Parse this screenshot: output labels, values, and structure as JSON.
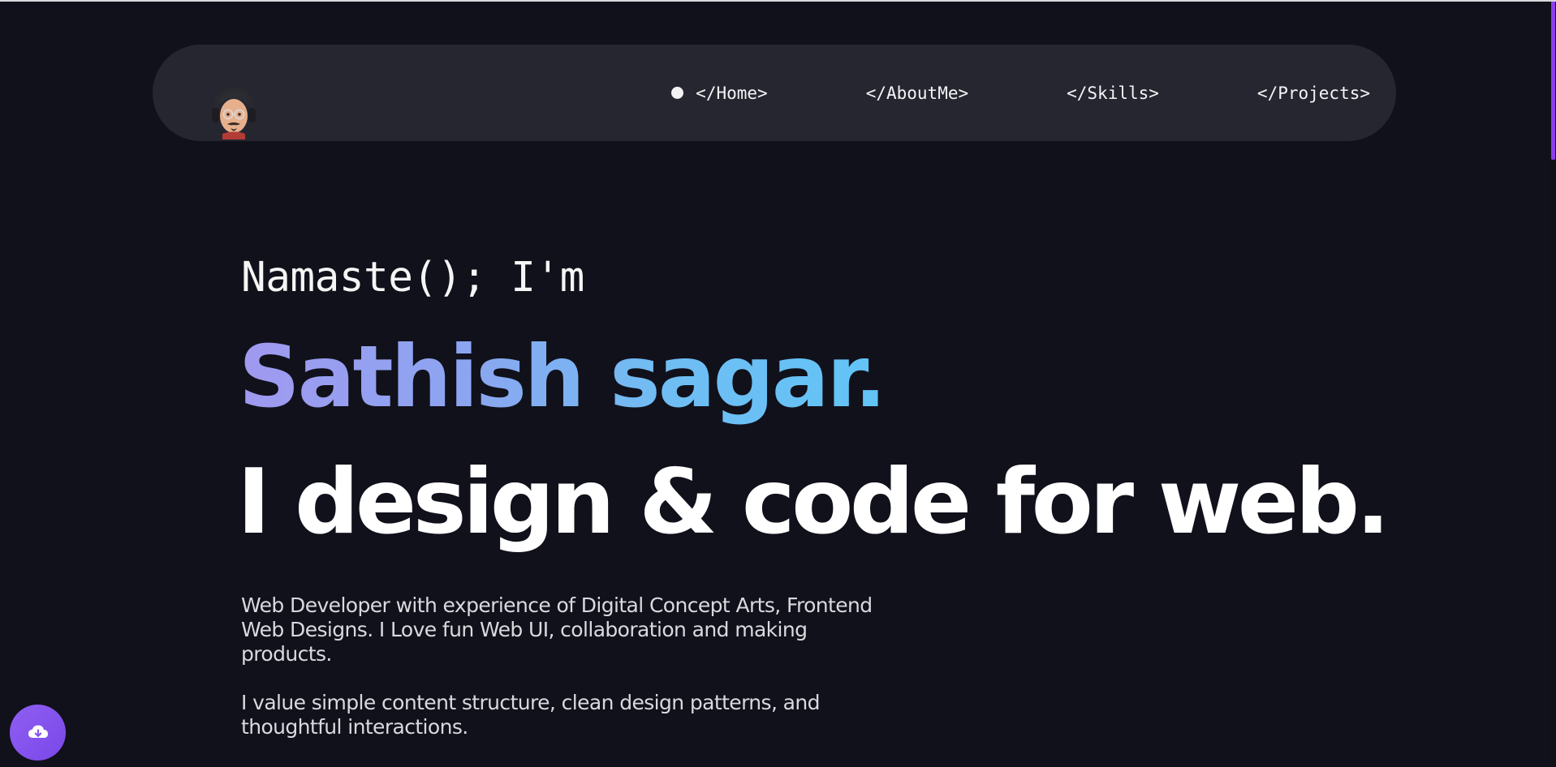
{
  "nav": {
    "links": [
      {
        "label": "</Home>",
        "active": true
      },
      {
        "label": "</AboutMe>",
        "active": false
      },
      {
        "label": "</Skills>",
        "active": false
      },
      {
        "label": "</Projects>",
        "active": false
      }
    ]
  },
  "hero": {
    "greeting": "Namaste(); I'm",
    "name": "Sathish sagar.",
    "tagline": "I design & code for web.",
    "description_1": "Web Developer with experience of Digital Concept Arts, Frontend Web Designs. I Love fun Web UI, collaboration and making products.",
    "description_2": "I value simple content structure, clean design patterns, and thoughtful interactions."
  },
  "colors": {
    "background": "#11111b",
    "navbar": "#262631",
    "accent": "#8b3ff0",
    "name_gradient_start": "#a099f0",
    "name_gradient_end": "#62c4f6"
  },
  "icons": {
    "avatar": "avatar",
    "fab": "cloud-download-icon",
    "active_indicator": "dot-icon"
  }
}
